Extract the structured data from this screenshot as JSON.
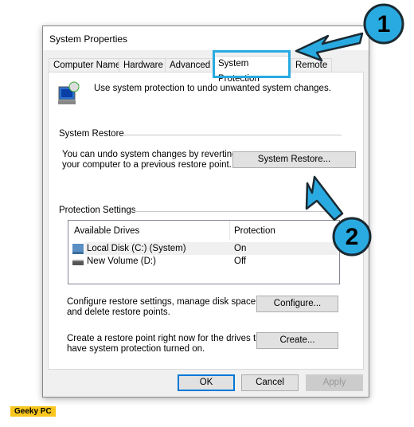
{
  "window": {
    "title": "System Properties",
    "close_icon": "close-icon"
  },
  "tabs": [
    {
      "label": "Computer Name"
    },
    {
      "label": "Hardware"
    },
    {
      "label": "Advanced"
    },
    {
      "label": "System Protection",
      "selected": true
    },
    {
      "label": "Remote"
    }
  ],
  "intro": "Use system protection to undo unwanted system changes.",
  "restore": {
    "group": "System Restore",
    "text1": "You can undo system changes by reverting",
    "text2": "your computer to a previous restore point.",
    "button": "System Restore..."
  },
  "protection": {
    "group": "Protection Settings",
    "columns": [
      "Available Drives",
      "Protection"
    ],
    "rows": [
      {
        "drive": "Local Disk (C:) (System)",
        "status": "On"
      },
      {
        "drive": "New Volume (D:)",
        "status": "Off"
      }
    ],
    "configure_text1": "Configure restore settings, manage disk space,",
    "configure_text2": "and delete restore points.",
    "configure_button": "Configure...",
    "create_text1": "Create a restore point right now for the drives that",
    "create_text2": "have system protection turned on.",
    "create_button": "Create..."
  },
  "footer": {
    "ok": "OK",
    "cancel": "Cancel",
    "apply": "Apply"
  },
  "annotations": {
    "step1": "1",
    "step2": "2",
    "color": "#29abe2"
  },
  "watermark": "Geeky PC"
}
